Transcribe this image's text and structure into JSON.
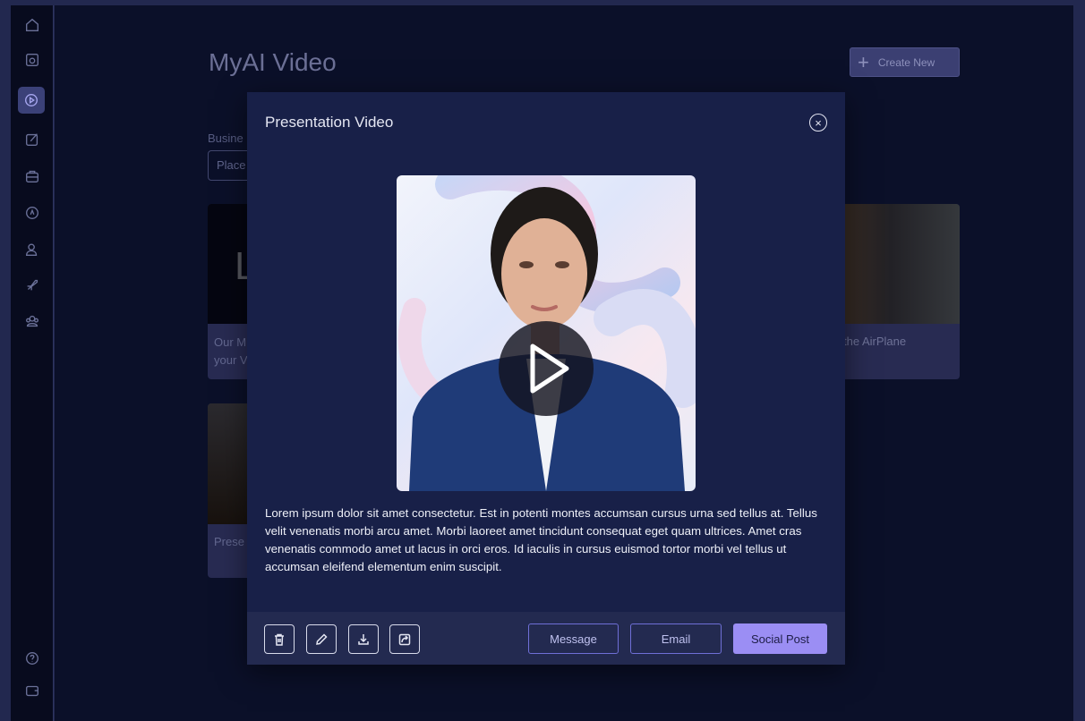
{
  "app": {
    "title": "MyAI Video",
    "create_label": "Create New"
  },
  "sidebar": {
    "icons": [
      "home-icon",
      "document-icon",
      "play-icon",
      "edit-icon",
      "briefcase-icon",
      "compass-icon",
      "user-icon",
      "rocket-icon",
      "group-icon",
      "help-icon",
      "wallet-icon"
    ],
    "active": "play-icon"
  },
  "background": {
    "filter_label": "Busine",
    "filter_placeholder": "Place",
    "cards": [
      {
        "caption_line1": "Our M",
        "caption_line2": "your V",
        "thumb_text": "L"
      },
      {
        "caption": "the AirPlane"
      },
      {
        "caption": "Prese"
      }
    ]
  },
  "modal": {
    "title": "Presentation Video",
    "description": "Lorem ipsum dolor sit amet consectetur. Est in potenti montes accumsan cursus urna sed tellus at. Tellus velit venenatis morbi arcu amet. Morbi laoreet amet tincidunt consequat eget quam ultrices. Amet cras venenatis commodo amet ut lacus in orci eros. Id iaculis in cursus euismod tortor morbi vel tellus ut accumsan eleifend elementum enim suscipit.",
    "footer": {
      "icon_buttons": [
        "trash-icon",
        "pencil-icon",
        "download-icon",
        "share-icon"
      ],
      "message_label": "Message",
      "email_label": "Email",
      "social_label": "Social Post"
    }
  },
  "colors": {
    "accent": "#9b8ef4",
    "modal_bg": "#182048",
    "page_bg": "#0b1029"
  }
}
